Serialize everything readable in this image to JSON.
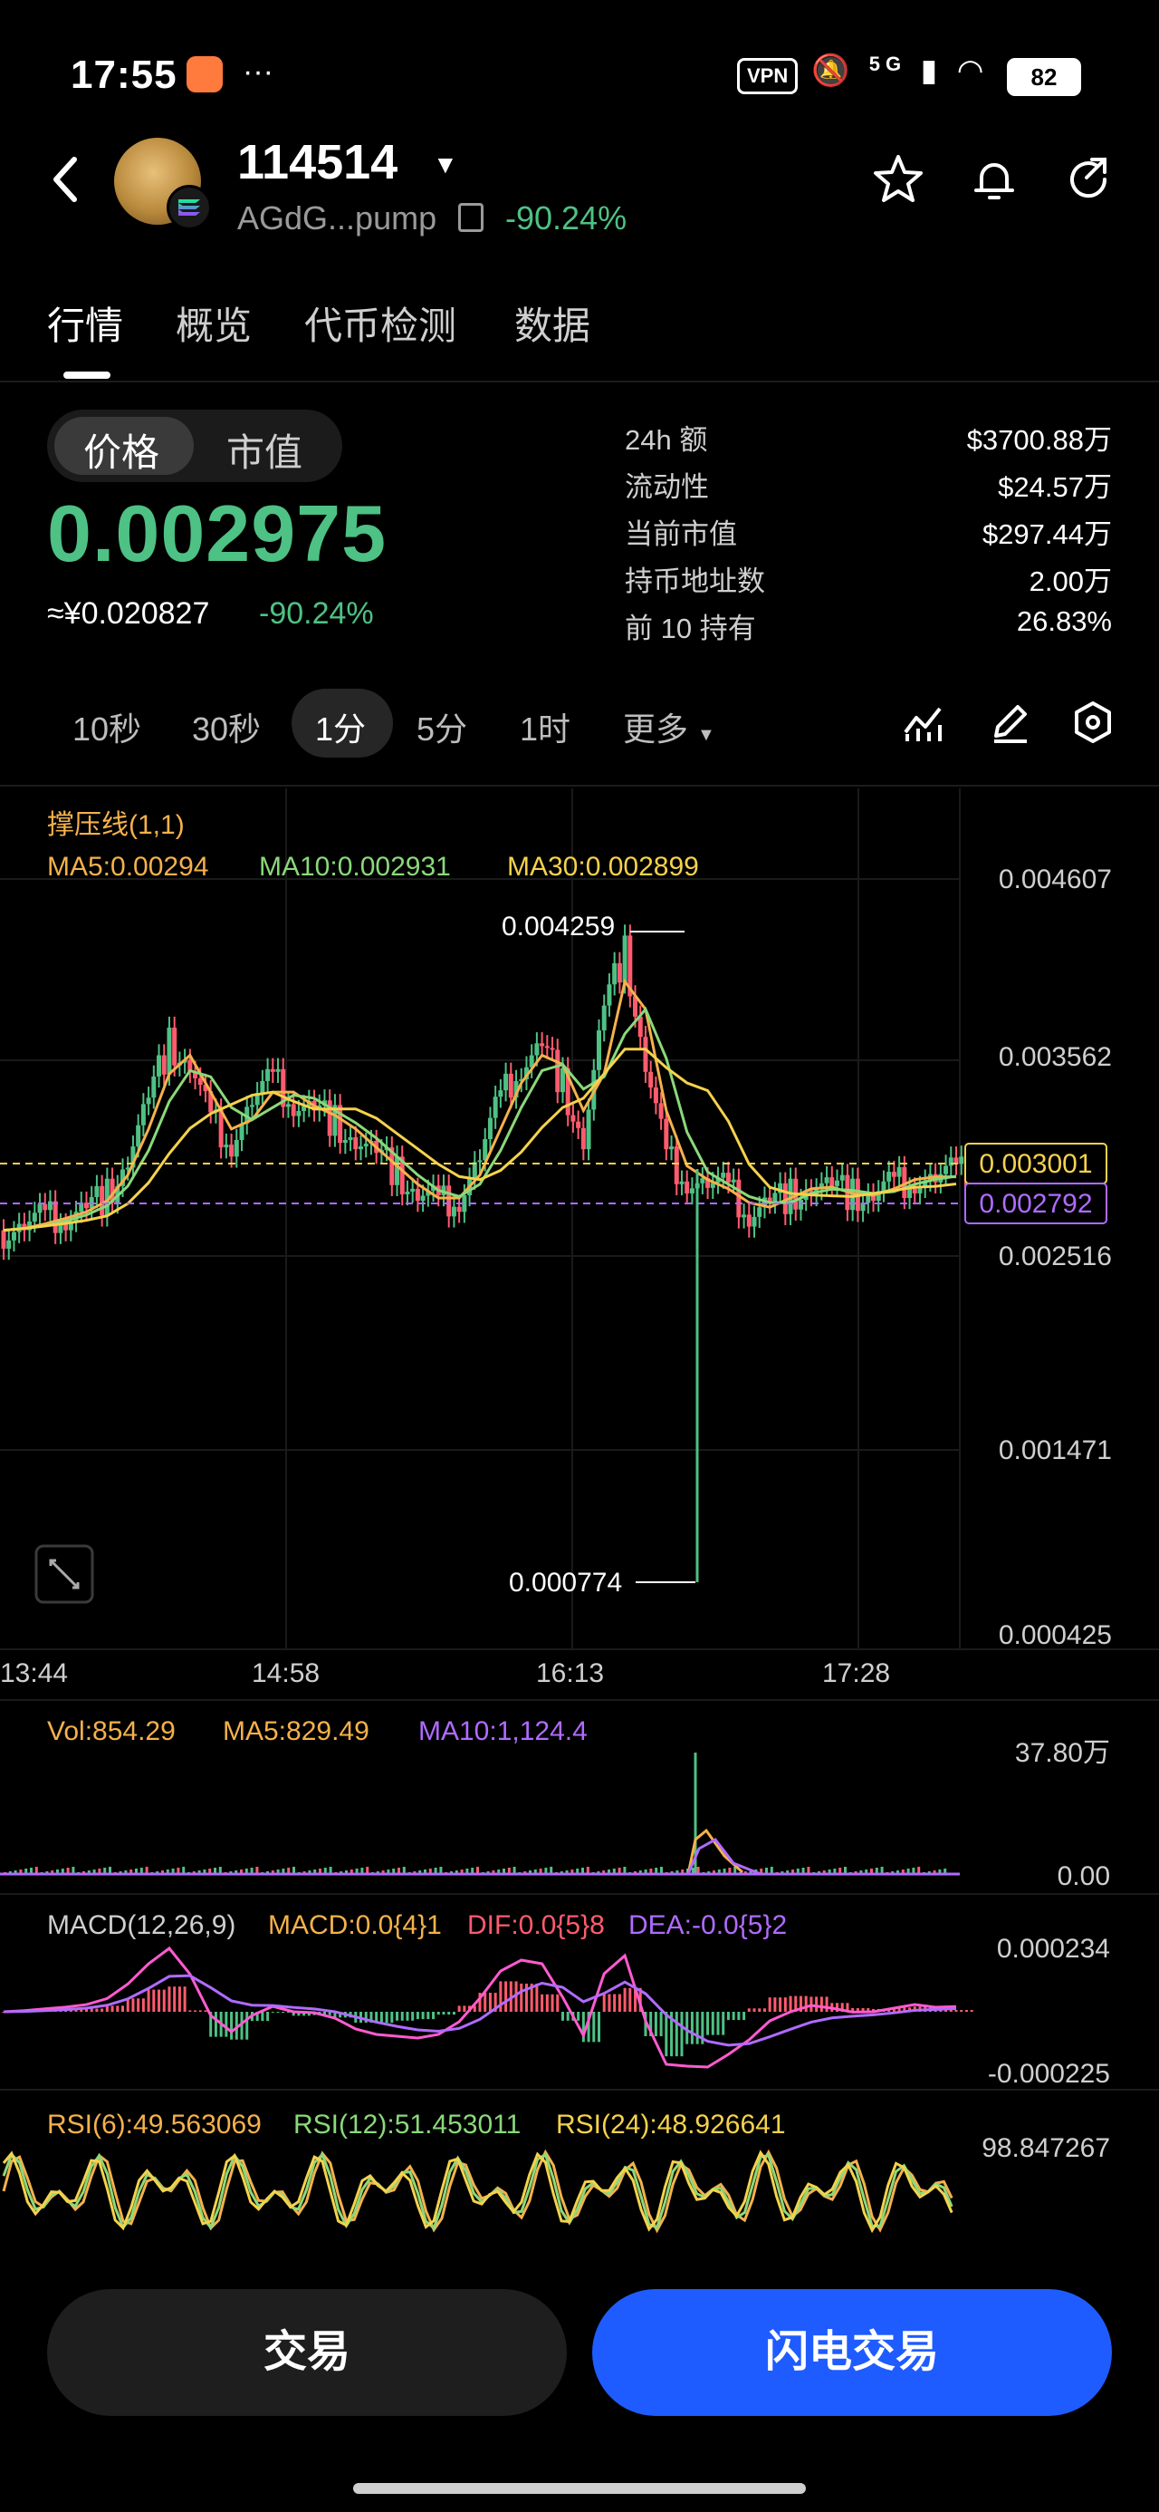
{
  "status_bar": {
    "time": "17:55",
    "dots": "···",
    "vpn": "VPN",
    "network": "5G",
    "battery": "82"
  },
  "header": {
    "ticker": "114514",
    "address": "AGdG...pump",
    "change": "-90.24%",
    "icons": [
      "back-icon",
      "star-icon",
      "bell-icon",
      "share-icon",
      "copy-icon"
    ]
  },
  "tabs": [
    {
      "label": "行情",
      "active": true
    },
    {
      "label": "概览"
    },
    {
      "label": "代币检测"
    },
    {
      "label": "数据"
    }
  ],
  "price_toggle": {
    "price": "价格",
    "market_cap": "市值",
    "selected": "价格"
  },
  "price": {
    "value": "0.002975",
    "cny": "≈¥0.020827",
    "change": "-90.24%"
  },
  "stats": [
    {
      "key": "24h  额",
      "value": "$3700.88万"
    },
    {
      "key": "流动性",
      "value": "$24.57万"
    },
    {
      "key": "当前市值",
      "value": "$297.44万"
    },
    {
      "key": "持币地址数",
      "value": "2.00万"
    },
    {
      "key": "前 10 持有",
      "value": "26.83%"
    }
  ],
  "intervals": [
    {
      "label": "10秒"
    },
    {
      "label": "30秒"
    },
    {
      "label": "1分",
      "active": true
    },
    {
      "label": "5分"
    },
    {
      "label": "1时"
    },
    {
      "label": "更多"
    }
  ],
  "chart_tools": [
    "indicator-icon",
    "draw-pencil-icon",
    "settings-hex-icon",
    "expand-icon"
  ],
  "colors": {
    "up": "#4ec184",
    "down": "#ff5b6e",
    "ma5": "#f5b14c",
    "ma10": "#8ad97a",
    "ma30": "#f5d24c",
    "accent_button": "#1f5cff",
    "purple": "#b06bff"
  },
  "chart_data": [
    {
      "type": "candlestick",
      "title": "撑压线(1,1)",
      "legend": [
        "MA5:0.00294",
        "MA10:0.002931",
        "MA30:0.002899"
      ],
      "y_ticks": [
        "0.004607",
        "0.003562",
        "0.002516",
        "0.001471",
        "0.000425"
      ],
      "ylim": [
        0.000425,
        0.004607
      ],
      "x_ticks": [
        "13:44",
        "14:58",
        "16:13",
        "17:28"
      ],
      "annotations": {
        "high": "0.004259",
        "low": "0.000774"
      },
      "lines": {
        "resistance": "0.003001",
        "support": "0.002792"
      },
      "close_series": [
        0.0027,
        0.00272,
        0.00275,
        0.00278,
        0.00282,
        0.0029,
        0.0031,
        0.0034,
        0.0037,
        0.0036,
        0.0033,
        0.0032,
        0.0034,
        0.0035,
        0.0034,
        0.00335,
        0.0033,
        0.0032,
        0.0031,
        0.003,
        0.0029,
        0.00285,
        0.0029,
        0.0031,
        0.0034,
        0.0036,
        0.0037,
        0.0035,
        0.0032,
        0.0039,
        0.0042,
        0.0036,
        0.0031,
        0.003,
        0.00295,
        0.0029,
        0.0028,
        0.00285,
        0.0029,
        0.00295,
        0.00292,
        0.00288,
        0.0029,
        0.00295,
        0.003,
        0.00298,
        0.003
      ]
    },
    {
      "type": "bar",
      "legend": [
        "Vol:854.29",
        "MA5:829.49",
        "MA10:1,124.4"
      ],
      "y_ticks": [
        "37.80万",
        "0.00"
      ]
    },
    {
      "type": "line",
      "legend": [
        "MACD(12,26,9)",
        "MACD:0.0{4}1",
        "DIF:0.0{5}8",
        "DEA:-0.0{5}2"
      ],
      "y_ticks": [
        "0.000234",
        "-0.000225"
      ]
    },
    {
      "type": "line",
      "legend": [
        "RSI(6):49.563069",
        "RSI(12):51.453011",
        "RSI(24):48.926641"
      ],
      "y_ticks": [
        "98.847267"
      ]
    }
  ],
  "buttons": {
    "trade": "交易",
    "flash_trade": "闪电交易"
  }
}
